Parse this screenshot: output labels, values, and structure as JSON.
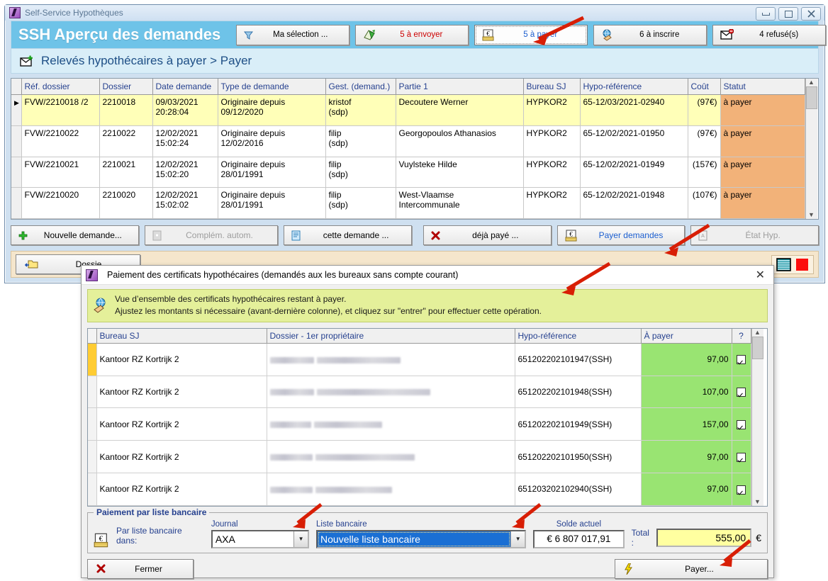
{
  "window": {
    "title": "Self-Service Hypothèques",
    "icon": "app-icon",
    "buttons": {
      "minimize": "minimize-icon",
      "maximize": "maximize-icon",
      "close": "close-icon"
    }
  },
  "header": {
    "title": "SSH  Aperçu des demandes",
    "buttons": [
      {
        "label": "Ma sélection ...",
        "icon": "filter-icon",
        "style": "normal",
        "selected": false
      },
      {
        "label": "5 à envoyer",
        "icon": "send-green-icon",
        "style": "red",
        "selected": false
      },
      {
        "label": "5 à payer",
        "icon": "euro-envelope-icon",
        "style": "blue",
        "selected": true
      },
      {
        "label": "6 à inscrire",
        "icon": "globe-hand-icon",
        "style": "normal",
        "selected": false
      },
      {
        "label": "4 refusé(s)",
        "icon": "mail-refused-icon",
        "style": "normal",
        "selected": false
      }
    ]
  },
  "subheader": {
    "icon": "mail-new-icon",
    "text": "Relevés hypothécaires à payer > Payer"
  },
  "main_grid": {
    "columns": [
      "Réf. dossier",
      "Dossier",
      "Date demande",
      "Type de demande",
      "Gest. (demand.)",
      "Partie 1",
      "Bureau SJ",
      "Hypo-référence",
      "Coût",
      "Statut"
    ],
    "rows": [
      {
        "selected": true,
        "ref": "FVW/2210018 /2",
        "dossier": "2210018",
        "date": "09/03/2021\n20:28:04",
        "type": "Originaire depuis\n09/12/2020",
        "gest": "kristof\n(sdp)",
        "partie": "Decoutere Werner",
        "bureau": "HYPKOR2",
        "hypo": "65-12/03/2021-02940",
        "cout": "(97€)",
        "statut": "à payer"
      },
      {
        "selected": false,
        "ref": "FVW/2210022",
        "dossier": "2210022",
        "date": "12/02/2021\n15:02:24",
        "type": "Originaire depuis\n12/02/2016",
        "gest": "filip\n(sdp)",
        "partie": "Georgopoulos Athanasios",
        "bureau": "HYPKOR2",
        "hypo": "65-12/02/2021-01950",
        "cout": "(97€)",
        "statut": "à payer"
      },
      {
        "selected": false,
        "ref": "FVW/2210021",
        "dossier": "2210021",
        "date": "12/02/2021\n15:02:20",
        "type": "Originaire depuis\n28/01/1991",
        "gest": "filip\n(sdp)",
        "partie": "Vuylsteke Hilde",
        "bureau": "HYPKOR2",
        "hypo": "65-12/02/2021-01949",
        "cout": "(157€)",
        "statut": "à payer"
      },
      {
        "selected": false,
        "ref": "FVW/2210020",
        "dossier": "2210020",
        "date": "12/02/2021\n15:02:02",
        "type": "Originaire depuis\n28/01/1991",
        "gest": "filip\n(sdp)",
        "partie": "West-Vlaamse\nIntercommunale",
        "bureau": "HYPKOR2",
        "hypo": "65-12/02/2021-01948",
        "cout": "(107€)",
        "statut": "à payer"
      }
    ]
  },
  "toolbar": {
    "new_request": {
      "label": "Nouvelle demande...",
      "icon": "plus-green-icon",
      "enabled": true
    },
    "auto_complement": {
      "label": "Complém. autom.",
      "icon": "doc-plus-icon",
      "enabled": false
    },
    "this_request": {
      "label": "cette demande ...",
      "icon": "document-blue-icon",
      "enabled": true
    },
    "already_paid": {
      "label": "déjà payé ...",
      "icon": "x-red-icon",
      "enabled": true
    },
    "pay_requests": {
      "label": "Payer demandes",
      "icon": "euro-envelope-icon",
      "enabled": true,
      "active": true
    },
    "hyp_state": {
      "label": "État Hyp.",
      "icon": "pdf-icon",
      "enabled": false
    }
  },
  "bottom_strip": {
    "dossier_button": {
      "label": "Dossie",
      "icon": "folder-open-icon"
    },
    "status_icons": [
      "striped-list-icon",
      "red-square-icon"
    ]
  },
  "dialog": {
    "title": "Paiement des certificats hypothécaires (demandés aux les bureaux sans compte courant)",
    "icon": "app-icon",
    "close_label": "✕",
    "info": {
      "icon": "globe-hand-icon",
      "line1": "Vue d’ensemble des certificats hypothécaires restant à payer.",
      "line2": "Ajustez les montants si nécessaire (avant-dernière colonne), et cliquez sur \"entrer\" pour effectuer cette opération."
    },
    "grid": {
      "columns": [
        "Bureau SJ",
        "Dossier - 1er propriétaire",
        "Hypo-référence",
        "À payer",
        "?"
      ],
      "rows": [
        {
          "current": true,
          "bureau": "Kantoor RZ Kortrijk 2",
          "proprietaire": "",
          "hypo": "651202202101947(SSH)",
          "a_payer": "97,00",
          "checked": true
        },
        {
          "current": false,
          "bureau": "Kantoor RZ Kortrijk 2",
          "proprietaire": "",
          "hypo": "651202202101948(SSH)",
          "a_payer": "107,00",
          "checked": true
        },
        {
          "current": false,
          "bureau": "Kantoor RZ Kortrijk 2",
          "proprietaire": "",
          "hypo": "651202202101949(SSH)",
          "a_payer": "157,00",
          "checked": true
        },
        {
          "current": false,
          "bureau": "Kantoor RZ Kortrijk 2",
          "proprietaire": "",
          "hypo": "651202202101950(SSH)",
          "a_payer": "97,00",
          "checked": true
        },
        {
          "current": false,
          "bureau": "Kantoor RZ Kortrijk 2",
          "proprietaire": "",
          "hypo": "651203202102940(SSH)",
          "a_payer": "97,00",
          "checked": true
        }
      ]
    },
    "payment_panel": {
      "legend": "Paiement par liste bancaire",
      "icon": "euro-envelope-icon",
      "prefix_label": "Par liste bancaire dans:",
      "journal_label": "Journal",
      "journal_value": "AXA",
      "bank_list_label": "Liste bancaire",
      "bank_list_value": "Nouvelle liste bancaire",
      "balance_label": "Solde actuel",
      "balance_value": "€ 6 807 017,91",
      "total_label": "Total :",
      "total_value": "555,00",
      "total_currency": "€"
    },
    "footer": {
      "close": {
        "label": "Fermer",
        "icon": "x-red-icon"
      },
      "pay": {
        "label": "Payer...",
        "icon": "lightning-icon"
      }
    }
  },
  "colors": {
    "header_bg": "#6ec3e8",
    "subheader_bg": "#d9eef8",
    "selected_row": "#ffffb8",
    "status_bg": "#f2b279",
    "status_text": "#8c3a00",
    "info_bg": "#e4f09a",
    "amount_bg": "#99e472",
    "total_bg": "#ffffa0",
    "combo_highlight": "#1a6fd4",
    "annotation_arrow": "#d81e05",
    "link_blue": "#1c5fd0",
    "count_red": "#cc0000",
    "strip_bg": "#f5e6cc"
  }
}
